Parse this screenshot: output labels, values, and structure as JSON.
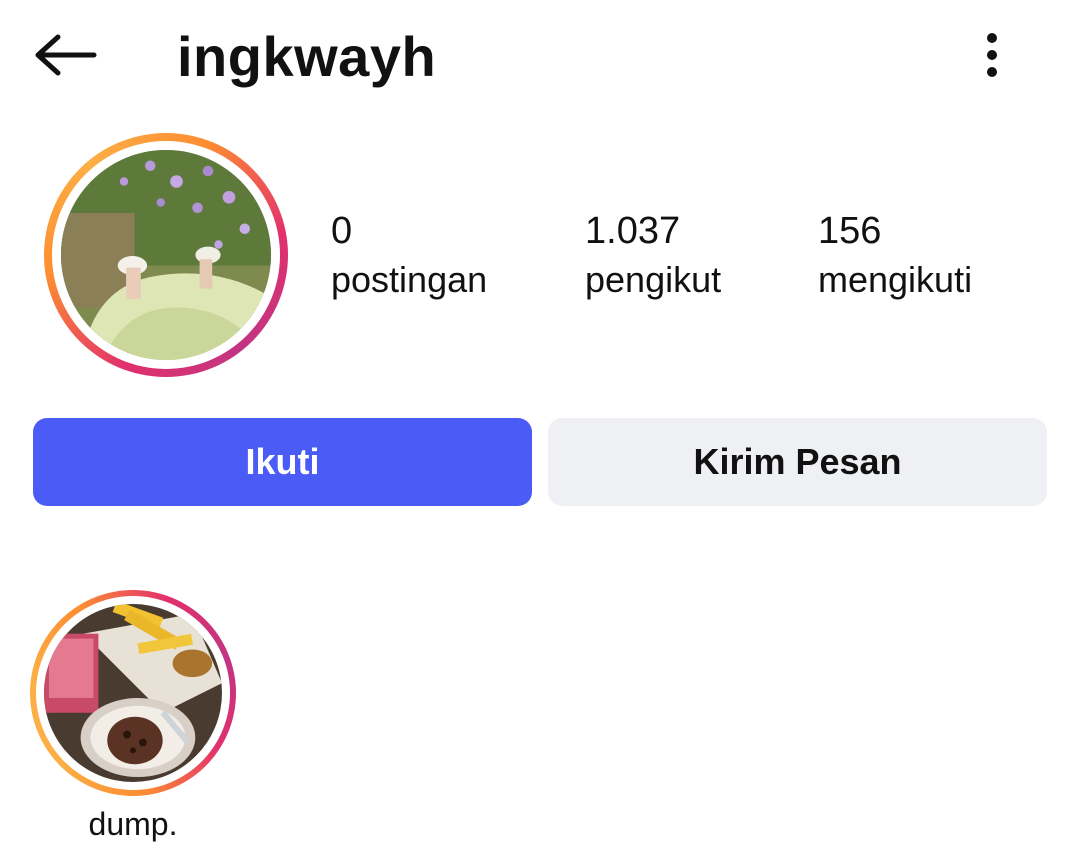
{
  "header": {
    "back_icon": "arrow-left-icon",
    "username": "ingkwayh",
    "more_icon": "more-vertical-icon"
  },
  "profile": {
    "avatar": "profile-photo",
    "stats": {
      "posts": {
        "count": "0",
        "label": "postingan"
      },
      "followers": {
        "count": "1.037",
        "label": "pengikut"
      },
      "following": {
        "count": "156",
        "label": "mengikuti"
      }
    }
  },
  "actions": {
    "follow_label": "Ikuti",
    "message_label": "Kirim Pesan"
  },
  "highlights": [
    {
      "label": "dump."
    }
  ],
  "colors": {
    "follow_button": "#4a5cf5",
    "message_button": "#eff0f3",
    "story_ring_pink": "#e1306c",
    "story_ring_orange": "#fcaf45"
  }
}
